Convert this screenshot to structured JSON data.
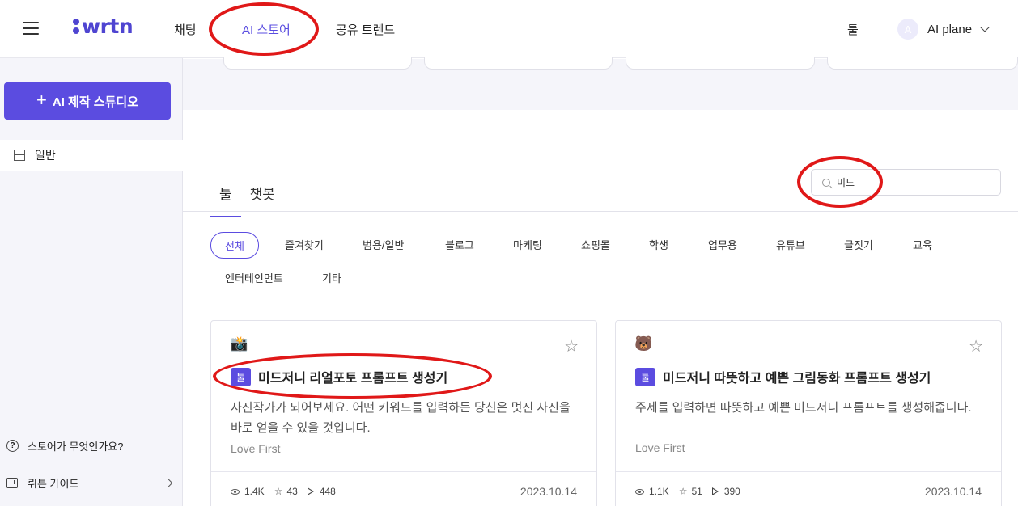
{
  "header": {
    "logo": "wrtn",
    "nav": [
      "채팅",
      "AI 스토어",
      "공유 트렌드"
    ],
    "tool_label": "툴",
    "avatar_letter": "A",
    "user_name": "AI plane"
  },
  "sidebar": {
    "studio_button": "AI 제작 스튜디오",
    "general_label": "일반",
    "help_label": "스토어가 무엇인가요?",
    "guide_label": "뤼튼 가이드"
  },
  "main": {
    "tabs": [
      "툴",
      "챗봇"
    ],
    "search_value": "미드",
    "categories": [
      "전체",
      "즐겨찾기",
      "범용/일반",
      "블로그",
      "마케팅",
      "쇼핑몰",
      "학생",
      "업무용",
      "유튜브",
      "글짓기",
      "교육",
      "엔터테인먼트",
      "기타"
    ]
  },
  "cards": [
    {
      "emoji": "📸",
      "badge": "툴",
      "title": "미드저니 리얼포토 프롬프트 생성기",
      "description": "사진작가가 되어보세요. 어떤 키워드를 입력하든 당신은 멋진 사진을 바로 얻을 수 있을 것입니다.",
      "author": "Love First",
      "views": "1.4K",
      "stars": "43",
      "plays": "448",
      "date": "2023.10.14"
    },
    {
      "emoji": "🐻",
      "badge": "툴",
      "title": "미드저니 따뜻하고 예쁜 그림동화 프롬프트 생성기",
      "description": "주제를 입력하면 따뜻하고 예쁜 미드저니 프롬프트를 생성해줍니다.",
      "author": "Love First",
      "views": "1.1K",
      "stars": "51",
      "plays": "390",
      "date": "2023.10.14"
    }
  ],
  "colors": {
    "brand": "#5b4ce0",
    "annotation": "#e01818"
  }
}
